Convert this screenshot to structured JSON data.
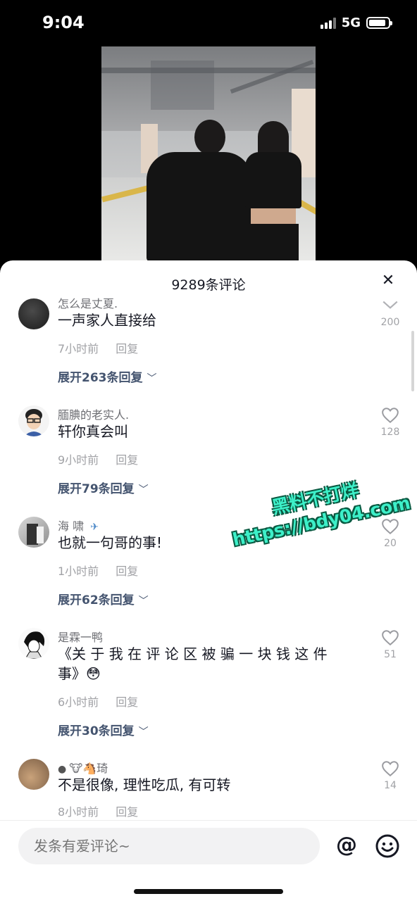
{
  "status": {
    "time": "9:04",
    "network": "5G",
    "battery_level": 0.9
  },
  "sheet": {
    "title": "9289条评论",
    "close_icon": "close-icon"
  },
  "comments": [
    {
      "username": "怎么是丈夏.",
      "text": "一声家人直接给",
      "time": "7小时前",
      "reply": "回复",
      "expand": "展开263条回复",
      "likes": "200"
    },
    {
      "username": "腼腆的老实人.",
      "text": "轩你真会叫",
      "time": "9小时前",
      "reply": "回复",
      "expand": "展开79条回复",
      "likes": "128"
    },
    {
      "username": "海 啸",
      "text": "也就一句哥的事!",
      "time": "1小时前",
      "reply": "回复",
      "expand": "展开62条回复",
      "likes": "20"
    },
    {
      "username": "是霖一鸭",
      "text": "《关 于 我 在 评 论 区 被 骗 一 块 钱 这 件 事》😳",
      "time": "6小时前",
      "reply": "回复",
      "expand": "展开30条回复",
      "likes": "51"
    },
    {
      "username": "🐮🐴琦",
      "text": "不是很像, 理性吃瓜, 有可转",
      "time": "8小时前",
      "reply": "回复",
      "likes": "14"
    }
  ],
  "watermark": {
    "line1": "黑料不打烊",
    "line2": "https://bdy04.com"
  },
  "input": {
    "placeholder": "发条有爱评论~",
    "at_symbol": "@"
  },
  "colors": {
    "accent_link": "#44546f",
    "watermark": "#3df0c9"
  }
}
